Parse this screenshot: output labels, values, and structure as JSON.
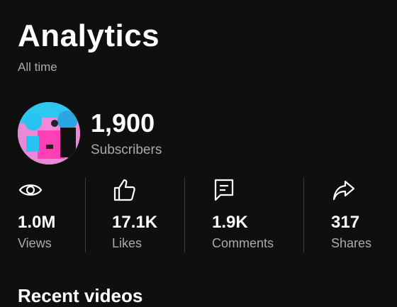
{
  "header": {
    "title": "Analytics",
    "subtitle": "All time"
  },
  "channel": {
    "subscriber_count": "1,900",
    "subscriber_label": "Subscribers",
    "avatar_icon": "profile-avatar"
  },
  "stats": [
    {
      "icon": "eye-icon",
      "value": "1.0M",
      "label": "Views"
    },
    {
      "icon": "thumbs-up-icon",
      "value": "17.1K",
      "label": "Likes"
    },
    {
      "icon": "comment-icon",
      "value": "1.9K",
      "label": "Comments"
    },
    {
      "icon": "share-icon",
      "value": "317",
      "label": "Shares"
    }
  ],
  "sections": {
    "recent_title": "Recent videos"
  },
  "colors": {
    "background": "#0f0f0f",
    "text_primary": "#ffffff",
    "text_secondary": "#aaaaaa",
    "divider": "#3a3a3a"
  }
}
